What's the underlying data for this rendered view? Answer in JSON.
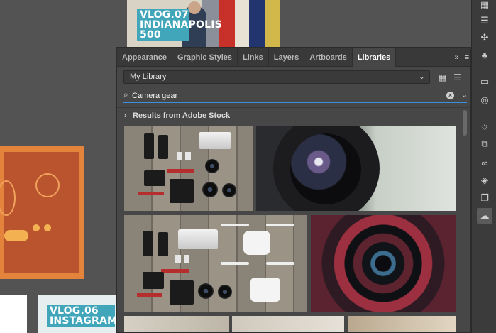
{
  "canvas": {
    "artboard_top": {
      "title_line1": "VLOG.07",
      "title_line2": "INDIANAPOLIS",
      "title_line3": "500"
    },
    "artboard_bottom": {
      "title_line1": "VLOG.06",
      "title_line2": "INSTAGRAM"
    }
  },
  "panel": {
    "tabs": [
      {
        "label": "Appearance",
        "active": false
      },
      {
        "label": "Graphic Styles",
        "active": false
      },
      {
        "label": "Links",
        "active": false
      },
      {
        "label": "Layers",
        "active": false
      },
      {
        "label": "Artboards",
        "active": false
      },
      {
        "label": "Libraries",
        "active": true
      }
    ],
    "tab_tools": {
      "collapse": "»",
      "menu": "≡"
    },
    "library_select": {
      "value": "My Library"
    },
    "search": {
      "value": "Camera gear",
      "placeholder": ""
    },
    "results_heading": "Results from Adobe Stock"
  },
  "toolstrip": {
    "icons": [
      "grid-panel-icon",
      "align-icon",
      "puzzle-icon",
      "club-icon",
      "gradient-icon",
      "transparency-icon",
      "sun-icon",
      "asset-export-icon",
      "link-icon",
      "layers-icon",
      "artboards-icon",
      "creative-cloud-libraries-icon"
    ]
  },
  "colors": {
    "panel_bg": "#474747",
    "tab_bg": "#393939",
    "accent_focus": "#3d8fd9",
    "canvas_bg": "#535353",
    "vlog_teal": "#41a6b9",
    "orange_art": "#e4843c"
  }
}
